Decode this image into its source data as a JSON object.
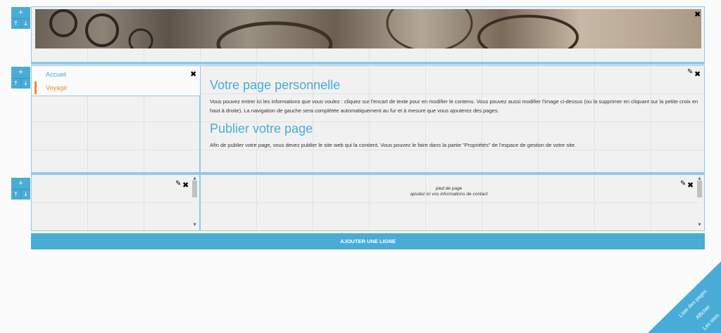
{
  "row_controls": {
    "add": "+",
    "up": "↑",
    "down": "↓"
  },
  "icons": {
    "close": "✖",
    "edit": "✎"
  },
  "nav": {
    "items": [
      {
        "label": "Accueil",
        "color": "#49acd6",
        "marker": "#ffffff"
      },
      {
        "label": "Voyage",
        "color": "#f08a24",
        "marker": "#f08a24"
      }
    ]
  },
  "content": {
    "title1": "Votre page personnelle",
    "para1": "Vous pouvez entrer ici les informations que vous voulez : cliquez sur l'encart de texte pour en modifier le contenu. Vous pouvez aussi modifier l'image ci-dessus (ou la supprimer en cliquant sur la petite croix en haut à droite). La navigation de gauche sera complétée automatiquement au fur et à mesure que vous ajouterez des pages.",
    "title2": "Publier votre page",
    "para2": "Afin de publier votre page, vous devez publier le site web qui la contient. Vous pouvez le faire dans la partie \"Propriétés\" de l'espace de gestion de votre site."
  },
  "footer": {
    "line1": "pied de page",
    "line2": "ajoutez ici vos informations de contact"
  },
  "add_row_label": "AJOUTER UNE LIGNE",
  "corner_links": [
    "Liste des pages",
    "Afficher",
    "Les sites"
  ],
  "colors": {
    "accent": "#49acd6",
    "orange": "#f08a24"
  }
}
